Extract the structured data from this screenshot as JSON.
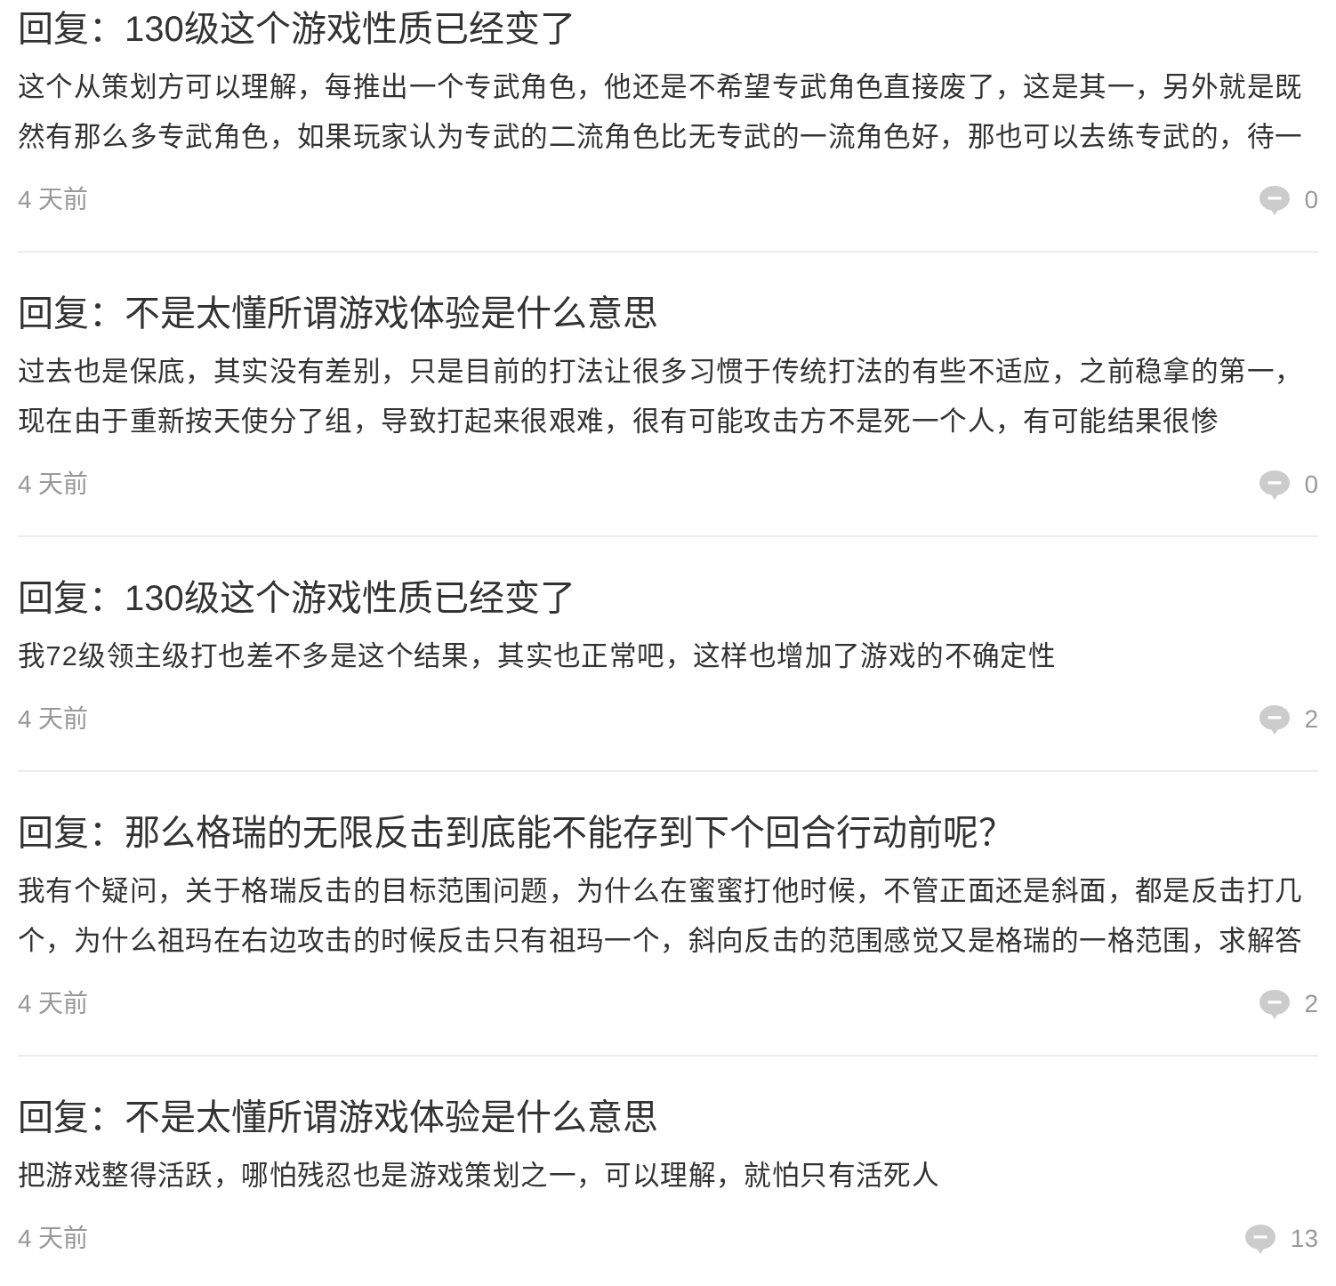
{
  "replies": [
    {
      "title": "回复：130级这个游戏性质已经变了",
      "body": "这个从策划方可以理解，每推出一个专武角色，他还是不希望专武角色直接废了，这是其一，另外就是既然有那么多专武角色，如果玩家认为专武的二流角色比无专武的一流角色好，那也可以去练专武的，待一",
      "time": "4 天前",
      "comment_count": "0"
    },
    {
      "title": "回复：不是太懂所谓游戏体验是什么意思",
      "body": "过去也是保底，其实没有差别，只是目前的打法让很多习惯于传统打法的有些不适应，之前稳拿的第一，现在由于重新按天使分了组，导致打起来很艰难，很有可能攻击方不是死一个人，有可能结果很惨",
      "time": "4 天前",
      "comment_count": "0"
    },
    {
      "title": "回复：130级这个游戏性质已经变了",
      "body": "我72级领主级打也差不多是这个结果，其实也正常吧，这样也增加了游戏的不确定性",
      "time": "4 天前",
      "comment_count": "2"
    },
    {
      "title": "回复：那么格瑞的无限反击到底能不能存到下个回合行动前呢？",
      "body": "我有个疑问，关于格瑞反击的目标范围问题，为什么在蜜蜜打他时候，不管正面还是斜面，都是反击打几个，为什么祖玛在右边攻击的时候反击只有祖玛一个，斜向反击的范围感觉又是格瑞的一格范围，求解答",
      "time": "4 天前",
      "comment_count": "2"
    },
    {
      "title": "回复：不是太懂所谓游戏体验是什么意思",
      "body": "把游戏整得活跃，哪怕残忍也是游戏策划之一，可以理解，就怕只有活死人",
      "time": "4 天前",
      "comment_count": "13"
    }
  ]
}
